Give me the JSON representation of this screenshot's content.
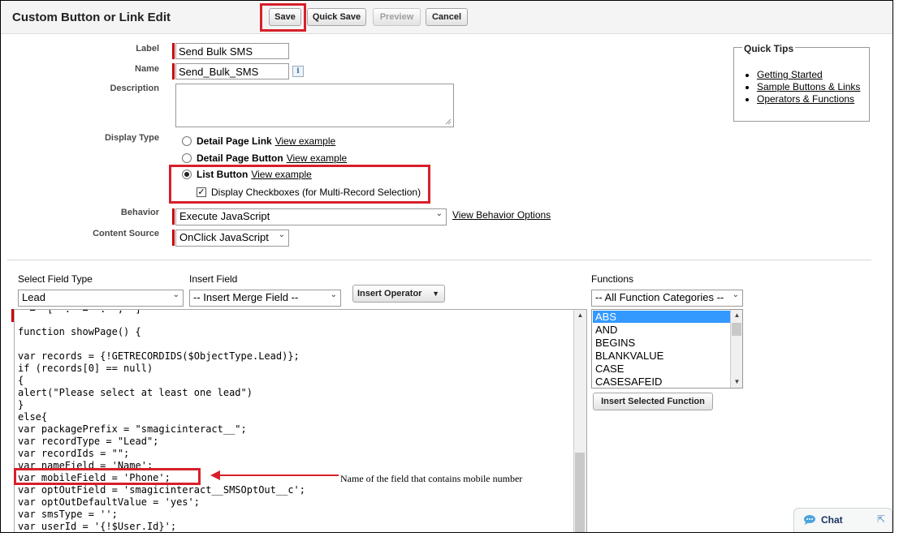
{
  "header": {
    "title": "Custom Button or Link Edit",
    "buttons": {
      "save": "Save",
      "quick_save": "Quick Save",
      "preview": "Preview",
      "cancel": "Cancel"
    }
  },
  "form": {
    "label": {
      "label": "Label",
      "value": "Send Bulk SMS"
    },
    "name": {
      "label": "Name",
      "value": "Send_Bulk_SMS",
      "info": "i"
    },
    "description": {
      "label": "Description",
      "value": ""
    },
    "display_type": {
      "label": "Display Type",
      "options": [
        {
          "name": "Detail Page Link",
          "link": "View example",
          "checked": false
        },
        {
          "name": "Detail Page Button",
          "link": "View example",
          "checked": false
        },
        {
          "name": "List Button",
          "link": "View example",
          "checked": true
        }
      ],
      "checkbox_label": "Display Checkboxes (for Multi-Record Selection)",
      "checkbox_checked": true
    },
    "behavior": {
      "label": "Behavior",
      "value": "Execute JavaScript",
      "link": "View Behavior Options"
    },
    "content_source": {
      "label": "Content Source",
      "value": "OnClick JavaScript"
    }
  },
  "quick_tips": {
    "title": "Quick Tips",
    "items": [
      "Getting Started",
      "Sample Buttons & Links",
      "Operators & Functions"
    ]
  },
  "formula_editor": {
    "select_field_type": {
      "label": "Select Field Type",
      "value": "Lead"
    },
    "insert_field": {
      "label": "Insert Field",
      "value": "-- Insert Merge Field --"
    },
    "insert_operator": "Insert Operator",
    "functions": {
      "label": "Functions",
      "category": "-- All Function Categories --",
      "items": [
        "ABS",
        "AND",
        "BEGINS",
        "BLANKVALUE",
        "CASE",
        "CASESAFEID"
      ],
      "selected": "ABS",
      "insert_button": "Insert Selected Function"
    },
    "code_lines": [
      "",
      "function showPage() {",
      "",
      "var records = {!GETRECORDIDS($ObjectType.Lead)};",
      "if (records[0] == null)",
      "{",
      "alert(\"Please select at least one lead\")",
      "}",
      "else{",
      "var packagePrefix = \"smagicinteract__\";",
      "var recordType = \"Lead\";",
      "var recordIds = \"\";",
      "var nameField = 'Name';",
      "var mobileField = 'Phone';",
      "var optOutField = 'smagicinteract__SMSOptOut__c';",
      "var optOutDefaultValue = 'yes';",
      "var smsType = '';",
      "var userId = '{!$User.Id}';"
    ]
  },
  "annotation": {
    "text": "Name of the field that contains mobile number",
    "highlight_color": "#d7202a"
  },
  "chat": {
    "label": "Chat"
  }
}
